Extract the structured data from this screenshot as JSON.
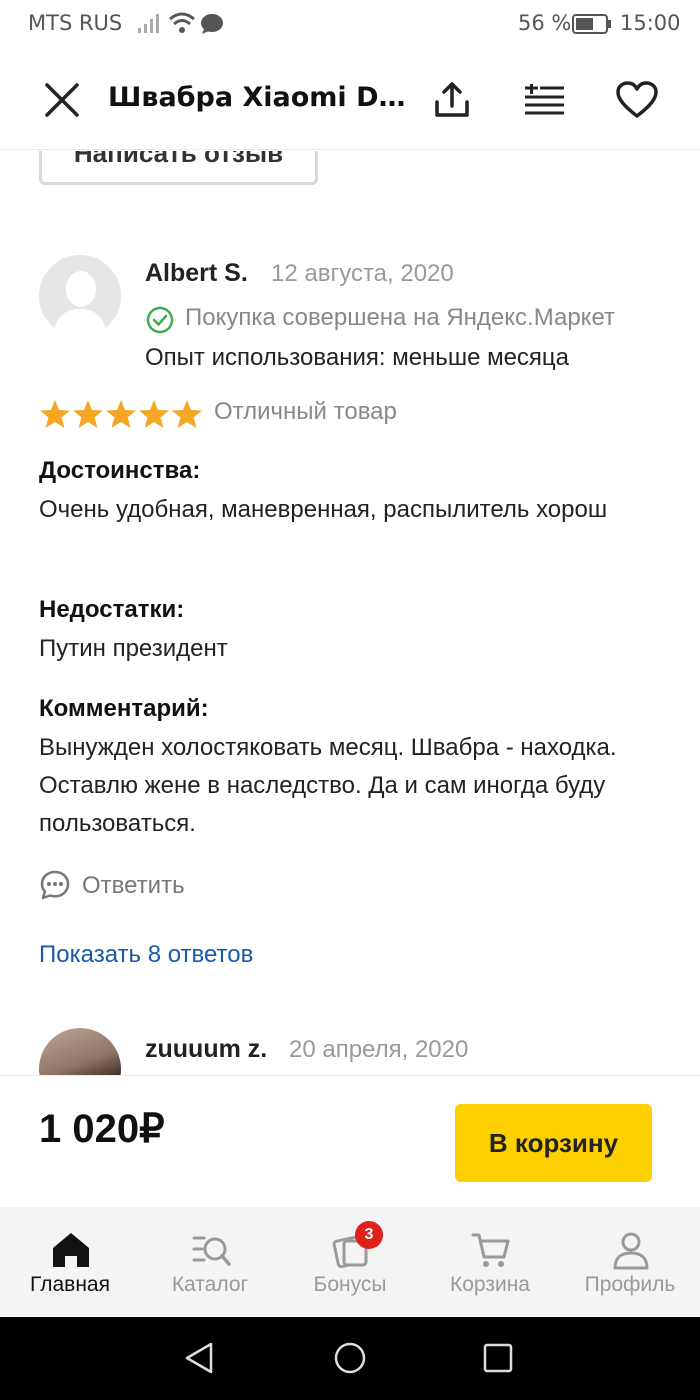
{
  "status_bar": {
    "carrier": "MTS RUS",
    "battery": "56 %",
    "time": "15:00"
  },
  "header": {
    "title": "Швабра Xiaomi Deerma Spray Mop"
  },
  "write_review_label": "Написать отзыв",
  "review": {
    "author": "Albert S.",
    "date": "12 августа, 2020",
    "verified": "Покупка совершена на Яндекс.Маркет",
    "experience": "Опыт использования: меньше месяца",
    "rating": 5,
    "rating_text": "Отличный товар",
    "pros_title": "Достоинства:",
    "pros_text": "Очень удобная, маневренная, распылитель хорош",
    "cons_title": "Недостатки:",
    "cons_text": "Путин президент",
    "comment_title": "Комментарий:",
    "comment_text": "Вынужден холостяковать месяц. Швабра - находка. Оставлю жене в наследство. Да и сам иногда буду пользоваться.",
    "reply_label": "Ответить",
    "show_answers": "Показать 8 ответов"
  },
  "next_review": {
    "author": "zuuuum z.",
    "date": "20 апреля, 2020"
  },
  "buy_bar": {
    "price": "1 020₽",
    "cart_button": "В корзину"
  },
  "bottom_nav": {
    "items": [
      {
        "label": "Главная",
        "icon": "home-icon"
      },
      {
        "label": "Каталог",
        "icon": "catalog-search-icon"
      },
      {
        "label": "Бонусы",
        "icon": "bonus-icon",
        "badge": "3"
      },
      {
        "label": "Корзина",
        "icon": "cart-icon"
      },
      {
        "label": "Профиль",
        "icon": "profile-icon"
      }
    ]
  },
  "colors": {
    "accent_yellow": "#ffd000",
    "star": "#f5a623",
    "link": "#1a5aa8",
    "verified_green": "#3dad4a",
    "badge_red": "#e0201a"
  }
}
